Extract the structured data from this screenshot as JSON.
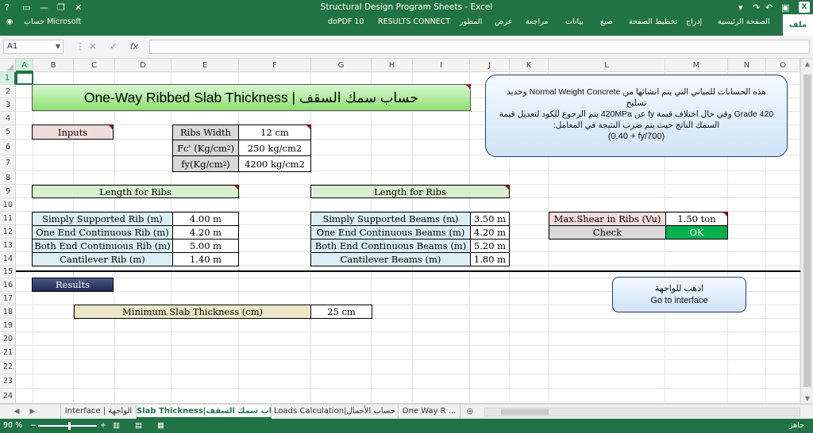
{
  "window": {
    "title": "Structural Design Program Sheets - Excel"
  },
  "account": {
    "label": "حساب Microsoft",
    "help": "?"
  },
  "ribbon": {
    "file": "ملف",
    "tabs": [
      "الصفحة الرئيسية",
      "إدراج",
      "تخطيط الصفحة",
      "صيغ",
      "بيانات",
      "مراجعة",
      "عرض",
      "المطور",
      "RESULTS CONNECT",
      "doPDF 10"
    ]
  },
  "formula": {
    "name_box": "A1",
    "fx": "fx",
    "cancel": "✕",
    "enter": "✓"
  },
  "columns": [
    "A",
    "B",
    "C",
    "D",
    "E",
    "F",
    "G",
    "H",
    "I",
    "J",
    "K",
    "L",
    "M",
    "N",
    "O"
  ],
  "rows": [
    "1",
    "2",
    "3",
    "4",
    "5",
    "6",
    "7",
    "8",
    "9",
    "10",
    "11",
    "12",
    "13",
    "14",
    "15",
    "16",
    "17",
    "18",
    "19",
    "20",
    "21",
    "22",
    "23",
    "24"
  ],
  "sheet": {
    "title": "One-Way Ribbed Slab Thickness | حساب سمك السقف",
    "inputs_label": "Inputs",
    "inputs": [
      {
        "label": "Ribs Width",
        "value": "12 cm"
      },
      {
        "label_main": "Fc' (Kg/cm",
        "label_sup": "2",
        "label_end": ")",
        "value": "250 kg/cm2"
      },
      {
        "label_main": "fy(Kg/cm",
        "label_sup": "2",
        "label_end": ")",
        "value": "4200 kg/cm2"
      }
    ],
    "note": {
      "line1": "هذه الحسابات للمباني التي يتم انشائها من Normal Weight Concrete وحديد تسليح",
      "line2": "Grade 420 وفي حال اختلاف قيمة fy عن 420MPa يتم الرجوع للكود لتعديل قيمة",
      "line3": "السمك الناتج حيث يتم ضرب النتيجة في المعامل:",
      "line4": "(0.40 + fy/700)"
    },
    "ribs_header": "Length for Ribs",
    "beams_header": "Length for Ribs",
    "ribs": [
      {
        "label": "Simply Supported Rib (m)",
        "value": "4.00 m"
      },
      {
        "label": "One End Continuous Rib (m)",
        "value": "4.20 m"
      },
      {
        "label": "Both End Continuous Rib (m)",
        "value": "5.00 m"
      },
      {
        "label": "Cantilever Rib (m)",
        "value": "1.40 m"
      }
    ],
    "beams": [
      {
        "label": "Simply Supported Beams (m)",
        "value": "3.50 m"
      },
      {
        "label": "One End Continuous Beams (m)",
        "value": "4.20 m"
      },
      {
        "label": "Both End Continuous Beams (m)",
        "value": "5.20 m"
      },
      {
        "label": "Cantilever Beams (m)",
        "value": "1.80 m"
      }
    ],
    "shear": {
      "label": "Max.Shear in Ribs (Vu)",
      "value": "1.50 ton",
      "check_label": "Check",
      "check_value": "OK"
    },
    "results_label": "Results",
    "goto": {
      "ar": "اذهب للواجهة",
      "en": "Go to interface"
    },
    "min_thickness": {
      "label": "Minimum Slab Thickness (cm)",
      "value": "25 cm"
    }
  },
  "tabs": [
    {
      "label": "Interface | الواجهة",
      "active": false
    },
    {
      "label": "Slab Thickness|حساب سمك السقف",
      "active": true
    },
    {
      "label": "Loads Calculation|حساب الأحمال",
      "active": false
    },
    {
      "label": "One Way R ...",
      "active": false
    }
  ],
  "status": {
    "ready": "جاهز",
    "zoom": "90 %",
    "minus": "−",
    "plus": "+"
  }
}
